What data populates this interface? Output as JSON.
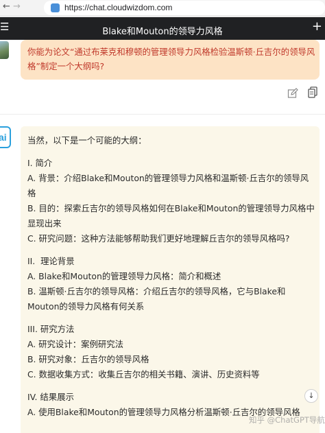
{
  "browser": {
    "back_icon": "arrow-left",
    "forward_icon": "arrow-right",
    "url": "https://chat.cloudwizdom.com"
  },
  "header": {
    "title": "Blake和Mouton的领导力风格",
    "menu_icon": "☰",
    "new_chat_icon": "+"
  },
  "user_message": {
    "text": "你能为论文“通过布莱克和穆顿的管理领导力风格检验温斯顿·丘吉尔的领导风格”制定一个大纲吗?"
  },
  "ai_message": {
    "avatar_text": "ai",
    "intro": "当然，以下是一个可能的大纲：",
    "sections": [
      {
        "heading": "I. 简介",
        "lines": [
          "A. 背景：介绍Blake和Mouton的管理领导力风格和温斯顿·丘吉尔的领导风格",
          "B. 目的：探索丘吉尔的领导风格如何在Blake和Mouton的管理领导力风格中显现出来",
          "C. 研究问题：这种方法能够帮助我们更好地理解丘吉尔的领导风格吗?"
        ]
      },
      {
        "heading": "II.  理论背景",
        "lines": [
          "A. Blake和Mouton的管理领导力风格：简介和概述",
          "B. 温斯顿·丘吉尔的领导风格：介绍丘吉尔的领导风格，它与Blake和Mouton的领导力风格有何关系"
        ]
      },
      {
        "heading": "III. 研究方法",
        "lines": [
          "A. 研究设计：案例研究法",
          "B. 研究对象：丘吉尔的领导风格",
          "C. 数据收集方式：收集丘吉尔的相关书籍、演讲、历史资料等"
        ]
      },
      {
        "heading": "IV. 结果展示",
        "lines": [
          "A. 使用Blake和Mouton的管理领导力风格分析温斯顿·丘吉尔的领导风格"
        ]
      }
    ]
  },
  "watermark": "知乎 @ChatGPT导航",
  "scroll_down_icon": "↓"
}
